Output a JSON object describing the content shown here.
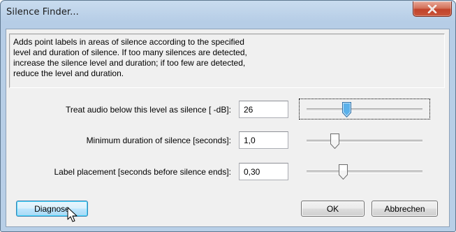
{
  "window": {
    "title": "Silence Finder...",
    "close_symbol": "X"
  },
  "description": "Adds point labels in areas of silence according to the specified\nlevel and duration of silence. If too many silences are detected,\nincrease the silence level and duration; if too few are detected,\nreduce the level and duration.",
  "fields": [
    {
      "label": "Treat audio below this level as silence [ -dB]:",
      "value": "26",
      "slider_fraction": 0.33,
      "focused": true
    },
    {
      "label": "Minimum duration of silence [seconds]:",
      "value": "1,0",
      "slider_fraction": 0.22,
      "focused": false
    },
    {
      "label": "Label placement [seconds before silence ends]:",
      "value": "0,30",
      "slider_fraction": 0.3,
      "focused": false
    }
  ],
  "buttons": {
    "diagnose": "Diagnose",
    "ok": "OK",
    "cancel": "Abbrechen"
  },
  "icons": {
    "close": "close-icon",
    "cursor": "mouse-pointer-icon"
  },
  "colors": {
    "titlebar": "#b8cfe7",
    "close_button": "#c9553b",
    "dialog_background": "#f0f0f0",
    "slider_thumb": "#3c9ad8"
  }
}
